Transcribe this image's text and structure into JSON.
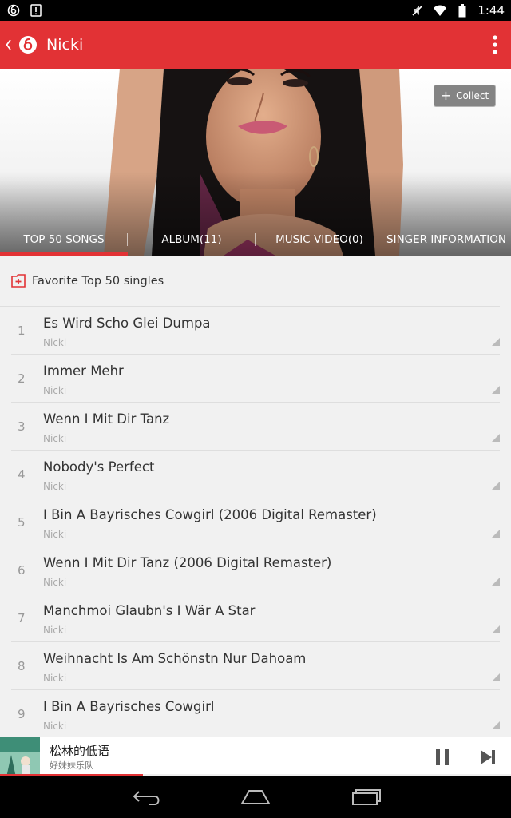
{
  "status_bar": {
    "time": "1:44",
    "icons": [
      "netease-music-icon",
      "alert-icon",
      "no-sound-icon",
      "wifi-icon",
      "battery-icon"
    ]
  },
  "app_bar": {
    "title": "Nicki",
    "color": "#e23235"
  },
  "hero": {
    "collect_label": "Collect"
  },
  "tabs": [
    {
      "label": "TOP 50 SONGS",
      "selected": true
    },
    {
      "label": "ALBUM(11)",
      "selected": false
    },
    {
      "label": "MUSIC VIDEO(0)",
      "selected": false
    },
    {
      "label": "SINGER INFORMATION",
      "selected": false
    }
  ],
  "favorite": {
    "label": "Favorite Top 50 singles"
  },
  "songs": [
    {
      "num": "1",
      "title": "Es Wird Scho Glei Dumpa",
      "artist": "Nicki"
    },
    {
      "num": "2",
      "title": "Immer Mehr",
      "artist": "Nicki"
    },
    {
      "num": "3",
      "title": "Wenn I Mit Dir Tanz",
      "artist": "Nicki"
    },
    {
      "num": "4",
      "title": "Nobody's Perfect",
      "artist": "Nicki"
    },
    {
      "num": "5",
      "title": "I Bin A Bayrisches Cowgirl (2006 Digital Remaster)",
      "artist": "Nicki"
    },
    {
      "num": "6",
      "title": "Wenn I Mit Dir Tanz (2006 Digital Remaster)",
      "artist": "Nicki"
    },
    {
      "num": "7",
      "title": "Manchmoi Glaubn's I Wär A Star",
      "artist": "Nicki"
    },
    {
      "num": "8",
      "title": "Weihnacht Is Am Schönstn Nur Dahoam",
      "artist": "Nicki"
    },
    {
      "num": "9",
      "title": "I Bin A Bayrisches Cowgirl",
      "artist": "Nicki"
    }
  ],
  "now_playing": {
    "title": "松林的低语",
    "artist": "好妹妹乐队",
    "progress": 0.28
  },
  "nav_bar": {
    "icons": [
      "back-nav-icon",
      "home-nav-icon",
      "recents-nav-icon"
    ]
  }
}
